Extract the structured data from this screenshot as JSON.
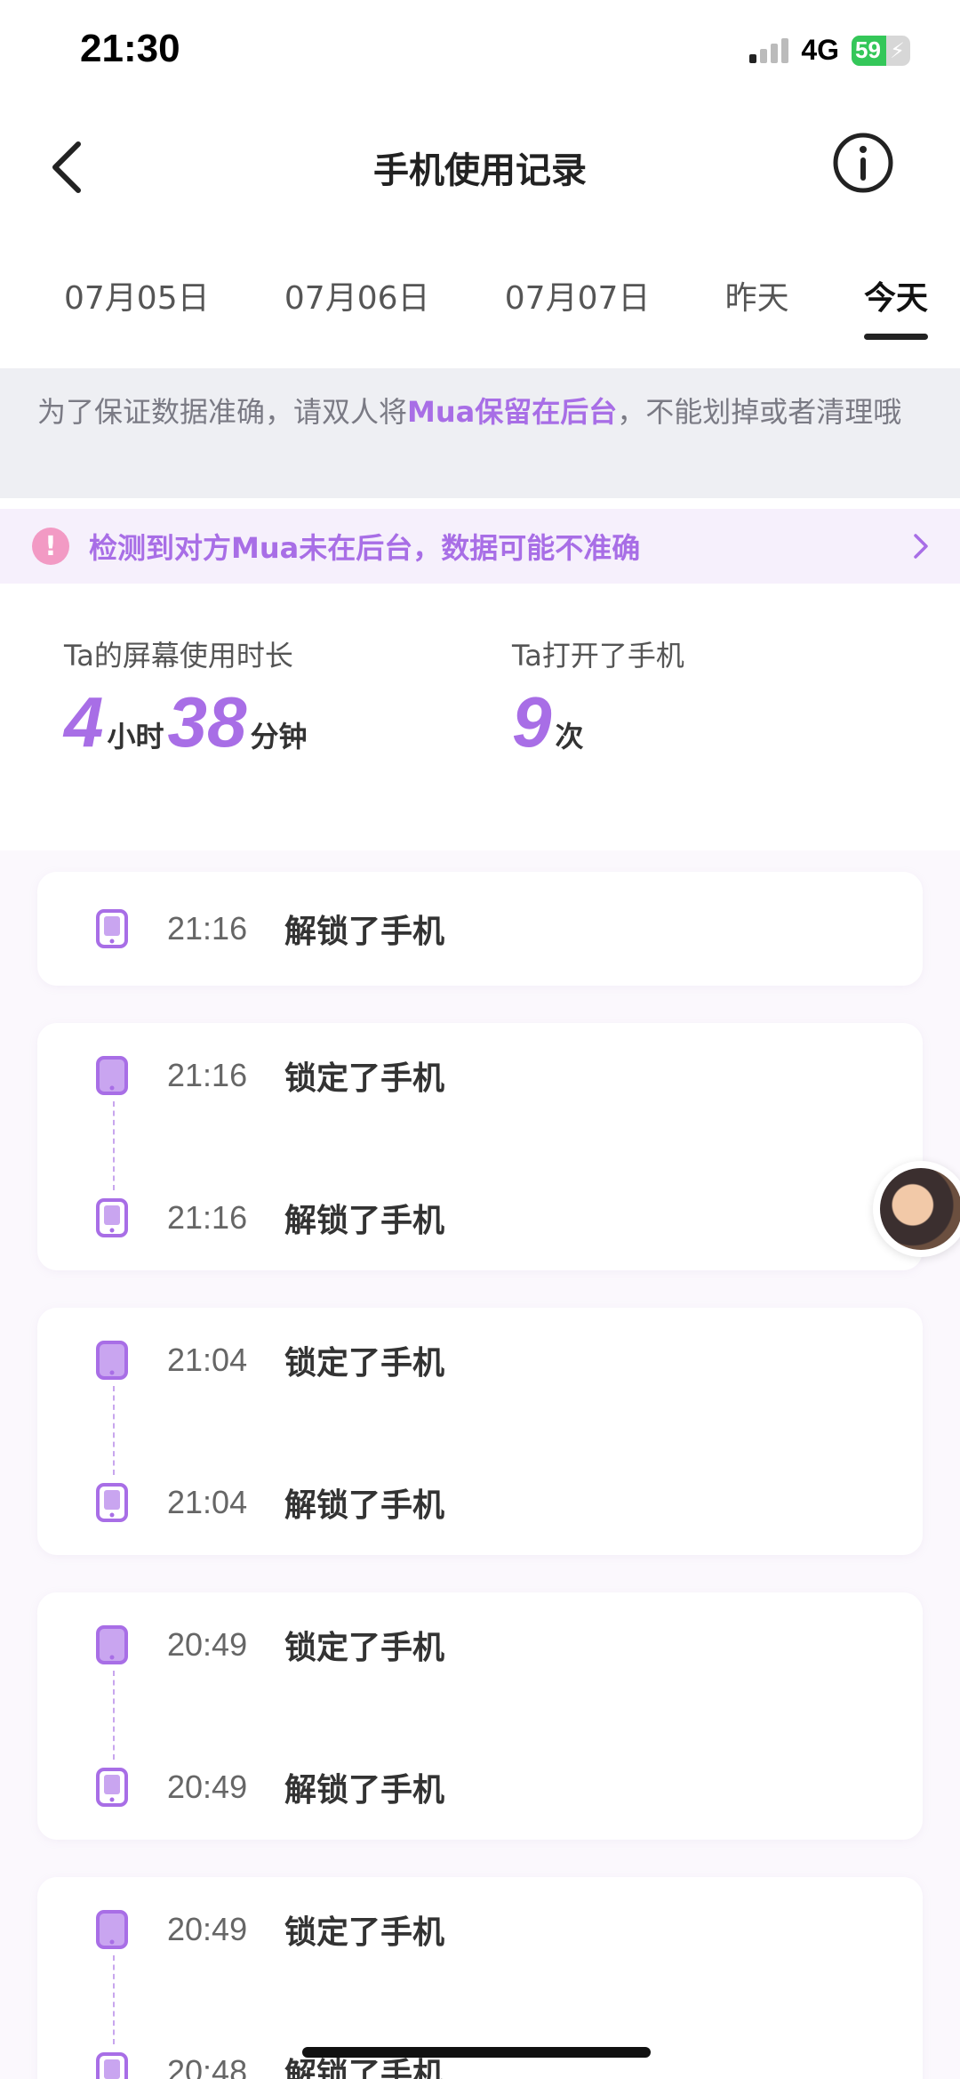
{
  "status_bar": {
    "time": "21:30",
    "network": "4G",
    "battery": "59",
    "battery_level_percent": 59
  },
  "nav": {
    "title": "手机使用记录"
  },
  "date_tabs": [
    {
      "label": "07月05日",
      "active": false
    },
    {
      "label": "07月06日",
      "active": false
    },
    {
      "label": "07月07日",
      "active": false
    },
    {
      "label": "昨天",
      "active": false
    },
    {
      "label": "今天",
      "active": true
    }
  ],
  "notice": {
    "prefix": "为了保证数据准确，请双人将",
    "highlight": "Mua保留在后台",
    "suffix": "，不能划掉或者清理哦"
  },
  "warning": {
    "icon": "!",
    "text": "检测到对方Mua未在后台，数据可能不准确"
  },
  "stats": {
    "screen_time_label": "Ta的屏幕使用时长",
    "hours": "4",
    "hours_unit": "小时",
    "minutes": "38",
    "minutes_unit": "分钟",
    "opens_label": "Ta打开了手机",
    "opens": "9",
    "opens_unit": "次"
  },
  "records": [
    {
      "time": "21:16",
      "text": "解锁了手机"
    },
    {
      "time": "21:16",
      "text": "锁定了手机"
    },
    {
      "time": "21:16",
      "text": "解锁了手机"
    },
    {
      "time": "21:04",
      "text": "锁定了手机"
    },
    {
      "time": "21:04",
      "text": "解锁了手机"
    },
    {
      "time": "20:49",
      "text": "锁定了手机"
    },
    {
      "time": "20:49",
      "text": "解锁了手机"
    },
    {
      "time": "20:49",
      "text": "锁定了手机"
    },
    {
      "time": "20:48",
      "text": "解锁了手机"
    }
  ],
  "colors": {
    "accent": "#a86ee6",
    "warning_icon": "#f29ac4",
    "battery": "#34c759"
  }
}
